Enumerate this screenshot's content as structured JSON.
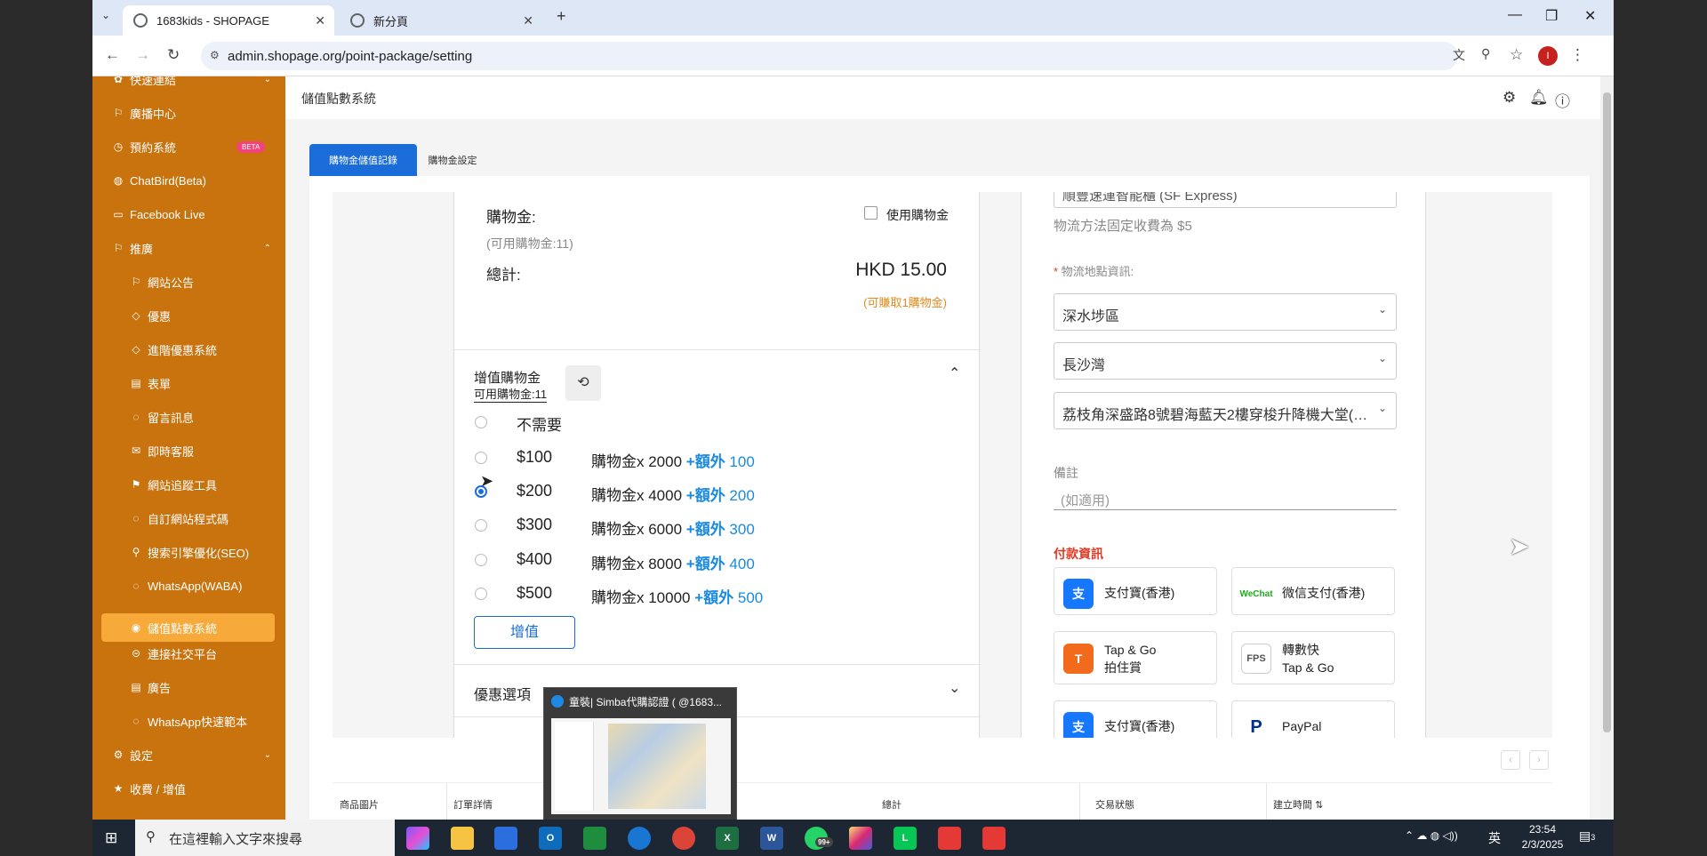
{
  "browser": {
    "tabs": [
      {
        "title": "1683kids - SHOPAGE"
      },
      {
        "title": "新分頁"
      }
    ],
    "url": "admin.shopage.org/point-package/setting",
    "profile_initial": "I"
  },
  "sidebar": {
    "items": [
      {
        "label": "快速連結"
      },
      {
        "label": "廣播中心"
      },
      {
        "label": "預約系統",
        "badge": "BETA"
      },
      {
        "label": "ChatBird(Beta)"
      },
      {
        "label": "Facebook Live"
      },
      {
        "label": "推廣"
      },
      {
        "label": "網站公告"
      },
      {
        "label": "優惠"
      },
      {
        "label": "進階優惠系統"
      },
      {
        "label": "表單"
      },
      {
        "label": "留言訊息"
      },
      {
        "label": "即時客服"
      },
      {
        "label": "網站追蹤工具"
      },
      {
        "label": "自訂網站程式碼"
      },
      {
        "label": "搜索引擎優化(SEO)"
      },
      {
        "label": "WhatsApp(WABA)"
      },
      {
        "label": "儲值點數系統"
      },
      {
        "label": "連接社交平台"
      },
      {
        "label": "廣告"
      },
      {
        "label": "WhatsApp快速範本"
      },
      {
        "label": "設定"
      },
      {
        "label": "收費 / 增值"
      }
    ]
  },
  "header": {
    "title": "儲值點數系統"
  },
  "page_tabs": [
    {
      "label": "購物金儲值記錄"
    },
    {
      "label": "購物金設定"
    }
  ],
  "checkout": {
    "points_label": "購物金:",
    "use_points_label": "使用購物金",
    "available_points": "(可用購物金:11)",
    "total_label": "總計:",
    "total_value": "HKD 15.00",
    "earn_note": "(可賺取1購物金)",
    "topup_title": "增值購物金",
    "topup_available": "可用購物金:11",
    "topup_none": "不需要",
    "topup_options": [
      {
        "price": "$100",
        "desc": "購物金x 2000 ",
        "bonus": "+額外",
        "bonus_value": " 100"
      },
      {
        "price": "$200",
        "desc": "購物金x 4000 ",
        "bonus": "+額外",
        "bonus_value": " 200"
      },
      {
        "price": "$300",
        "desc": "購物金x 6000 ",
        "bonus": "+額外",
        "bonus_value": " 300"
      },
      {
        "price": "$400",
        "desc": "購物金x 8000 ",
        "bonus": "+額外",
        "bonus_value": " 400"
      },
      {
        "price": "$500",
        "desc": "購物金x 10000 ",
        "bonus": "+額外",
        "bonus_value": " 500"
      }
    ],
    "selected_option_index": 1,
    "topup_button": "增值",
    "discount_title": "優惠選項"
  },
  "shipping": {
    "partial_value": "順豐速運智能櫃 (SF Express)",
    "fixed_fee_note": "物流方法固定收費為 $5",
    "location_label": "物流地點資訊:",
    "district": "深水埗區",
    "area": "長沙灣",
    "address": "荔枝角深盛路8號碧海藍天2樓穿梭升降機大堂(…",
    "remarks_label": "備註",
    "remarks_placeholder": "(如適用)"
  },
  "payment": {
    "title": "付款資訊",
    "methods": [
      {
        "label": "支付寶(香港)",
        "icon": "alipay-icon"
      },
      {
        "label": "微信支付(香港)",
        "icon": "wechat-pay-icon"
      },
      {
        "label": "Tap & Go\n拍住賞",
        "icon": "tapngo-icon"
      },
      {
        "label": "轉數快\nTap & Go",
        "icon": "fps-icon"
      },
      {
        "label": "支付寶(香港)",
        "icon": "alipay-icon"
      },
      {
        "label": "PayPal",
        "icon": "paypal-icon"
      }
    ]
  },
  "table": {
    "headers": [
      "商品圖片",
      "訂單詳情",
      "總計",
      "交易狀態",
      "建立時間"
    ]
  },
  "thumbnail": {
    "title": "童裝| Simba代購認證 ( @1683..."
  },
  "taskbar": {
    "search_placeholder": "在這裡輸入文字來搜尋",
    "whatsapp_badge": "99+",
    "ime": "英",
    "time": "23:54",
    "date": "2/3/2025",
    "notification_count": "3"
  },
  "colors": {
    "sidebar": "#c8730e",
    "sidebar_active": "#f7a93a",
    "primary": "#1a6cd8",
    "accent_bonus": "#1a8ae0",
    "payment_title": "#e03b24"
  }
}
